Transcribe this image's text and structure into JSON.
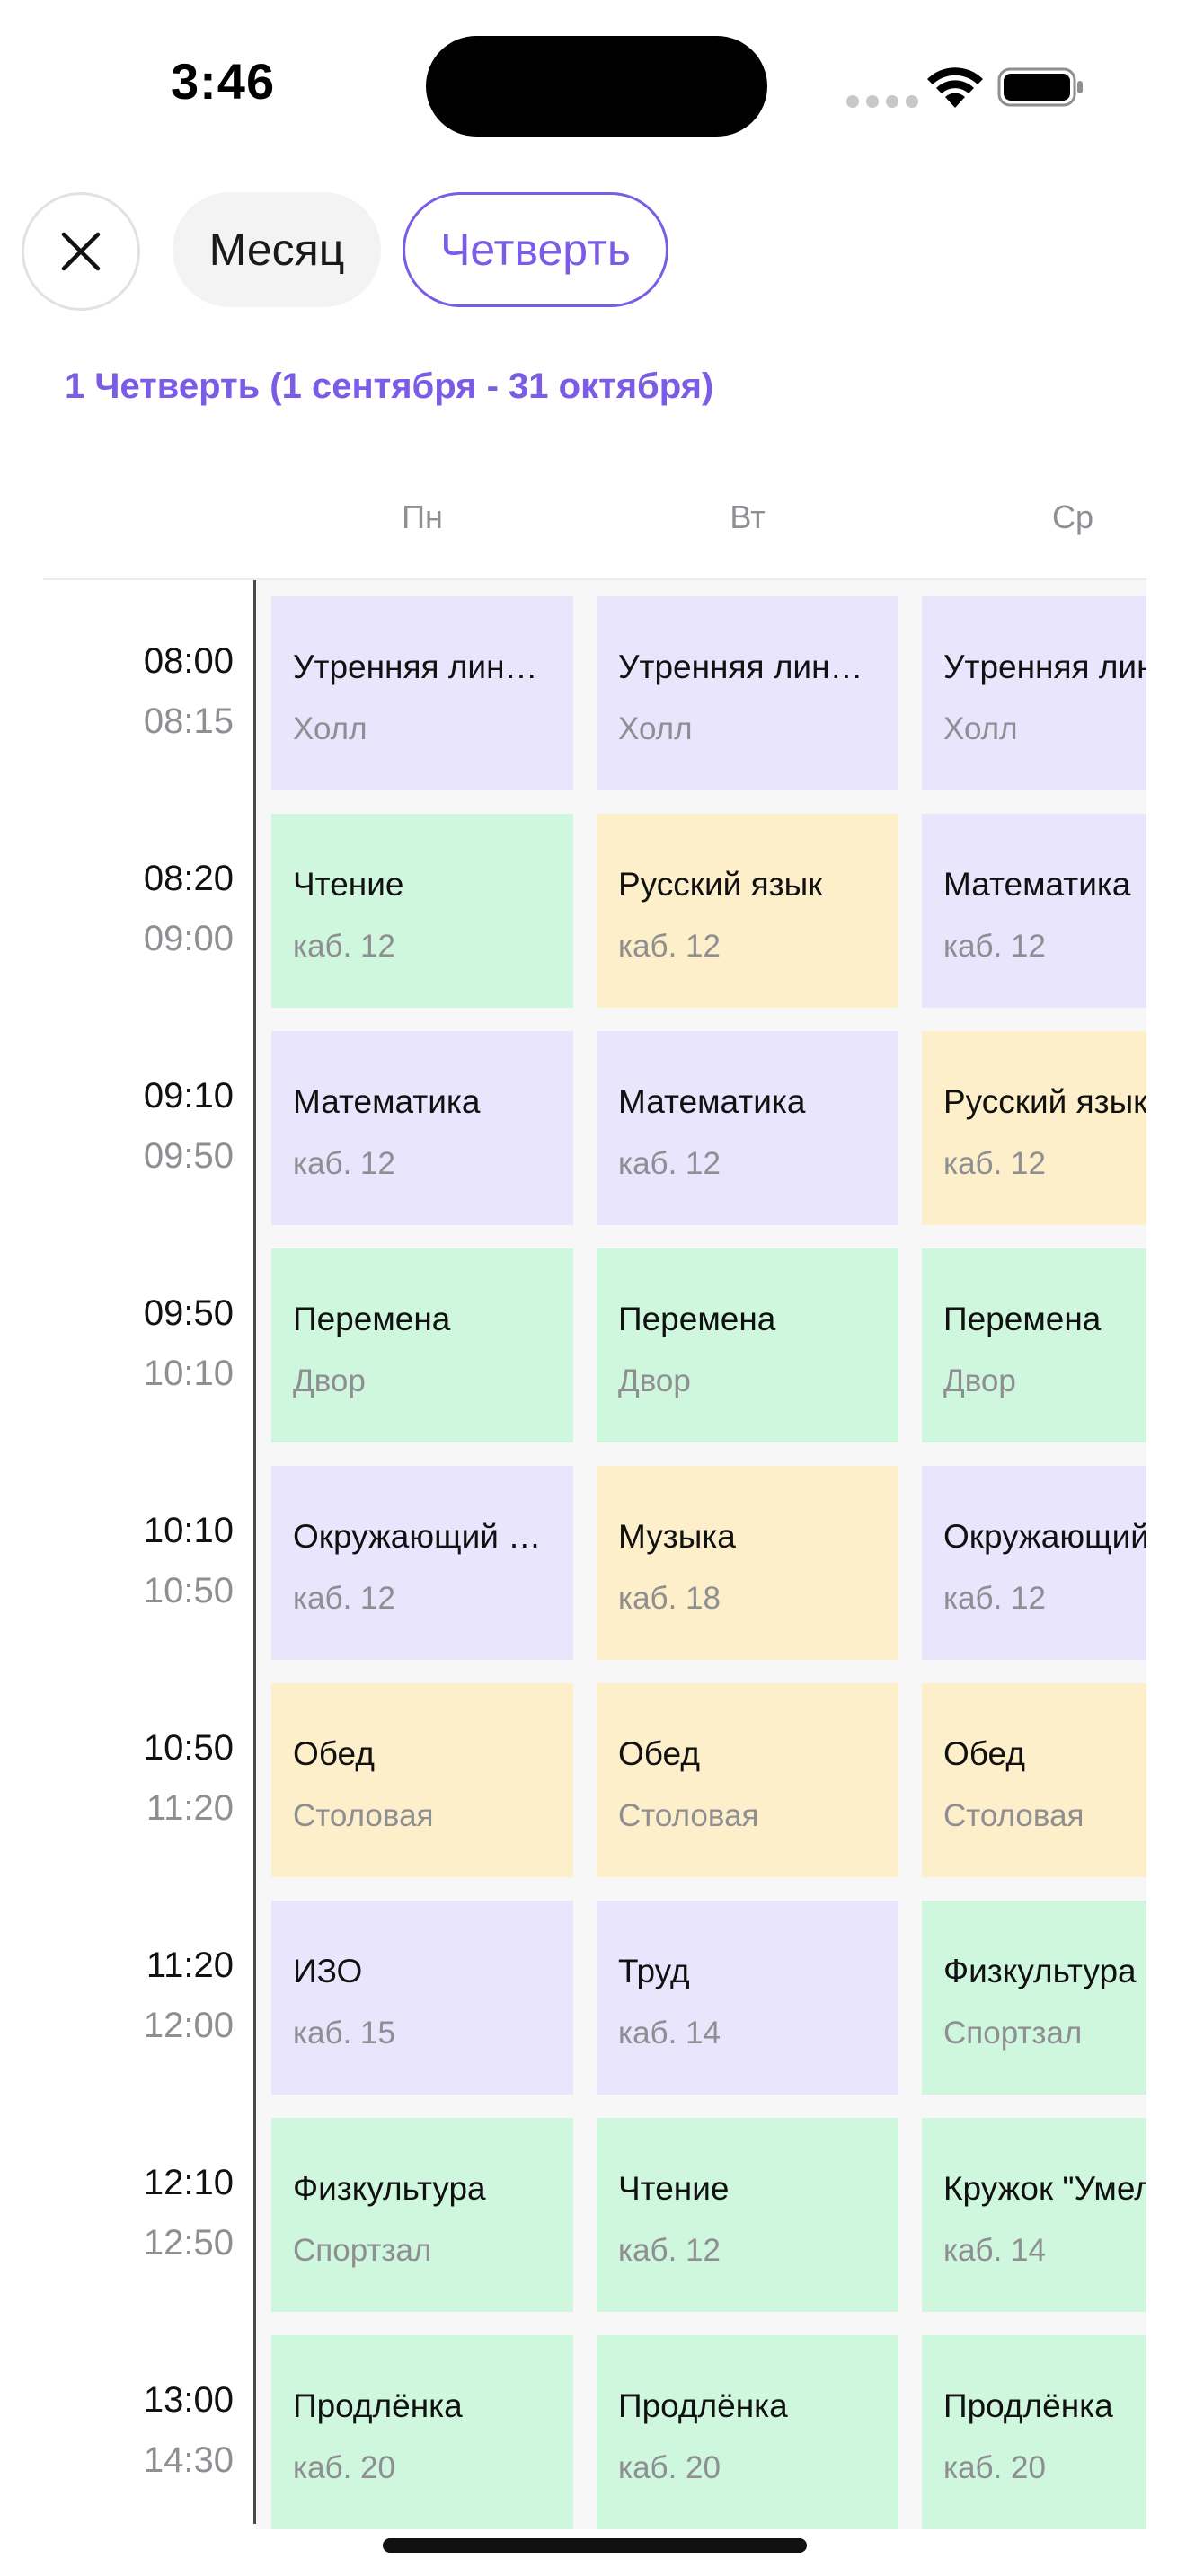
{
  "status_bar": {
    "time": "3:46"
  },
  "filters": {
    "month_label": "Месяц",
    "quarter_label": "Четверть",
    "selected": "Четверть"
  },
  "quarter_title": "1 Четверть (1 сентября - 31 октября)",
  "days": [
    "Пн",
    "Вт",
    "Ср"
  ],
  "colors": {
    "accent": "#7a5ce6",
    "purple": "#e8e5fd",
    "green": "#cff7dd",
    "yellow": "#fdefc9"
  },
  "slots": [
    {
      "start": "08:00",
      "end": "08:15",
      "lessons": [
        {
          "title": "Утренняя линейка",
          "room": "Холл",
          "color": "purple"
        },
        {
          "title": "Утренняя линейка",
          "room": "Холл",
          "color": "purple"
        },
        {
          "title": "Утренняя линейка",
          "room": "Холл",
          "color": "purple"
        }
      ]
    },
    {
      "start": "08:20",
      "end": "09:00",
      "lessons": [
        {
          "title": "Чтение",
          "room": "каб. 12",
          "color": "green"
        },
        {
          "title": "Русский язык",
          "room": "каб. 12",
          "color": "yellow"
        },
        {
          "title": "Математика",
          "room": "каб. 12",
          "color": "purple"
        }
      ]
    },
    {
      "start": "09:10",
      "end": "09:50",
      "lessons": [
        {
          "title": "Математика",
          "room": "каб. 12",
          "color": "purple"
        },
        {
          "title": "Математика",
          "room": "каб. 12",
          "color": "purple"
        },
        {
          "title": "Русский язык",
          "room": "каб. 12",
          "color": "yellow"
        }
      ]
    },
    {
      "start": "09:50",
      "end": "10:10",
      "lessons": [
        {
          "title": "Перемена",
          "room": "Двор",
          "color": "green"
        },
        {
          "title": "Перемена",
          "room": "Двор",
          "color": "green"
        },
        {
          "title": "Перемена",
          "room": "Двор",
          "color": "green"
        }
      ]
    },
    {
      "start": "10:10",
      "end": "10:50",
      "lessons": [
        {
          "title": "Окружающий мир",
          "room": "каб. 12",
          "color": "purple"
        },
        {
          "title": "Музыка",
          "room": "каб. 18",
          "color": "yellow"
        },
        {
          "title": "Окружающий мир",
          "room": "каб. 12",
          "color": "purple"
        }
      ]
    },
    {
      "start": "10:50",
      "end": "11:20",
      "lessons": [
        {
          "title": "Обед",
          "room": "Столовая",
          "color": "yellow"
        },
        {
          "title": "Обед",
          "room": "Столовая",
          "color": "yellow"
        },
        {
          "title": "Обед",
          "room": "Столовая",
          "color": "yellow"
        }
      ]
    },
    {
      "start": "11:20",
      "end": "12:00",
      "lessons": [
        {
          "title": "ИЗО",
          "room": "каб. 15",
          "color": "purple"
        },
        {
          "title": "Труд",
          "room": "каб. 14",
          "color": "purple"
        },
        {
          "title": "Физкультура",
          "room": "Спортзал",
          "color": "green"
        }
      ]
    },
    {
      "start": "12:10",
      "end": "12:50",
      "lessons": [
        {
          "title": "Физкультура",
          "room": "Спортзал",
          "color": "green"
        },
        {
          "title": "Чтение",
          "room": "каб. 12",
          "color": "green"
        },
        {
          "title": "Кружок \"Умелые руки\"",
          "room": "каб. 14",
          "color": "green"
        }
      ]
    },
    {
      "start": "13:00",
      "end": "14:30",
      "lessons": [
        {
          "title": "Продлёнка",
          "room": "каб. 20",
          "color": "green"
        },
        {
          "title": "Продлёнка",
          "room": "каб. 20",
          "color": "green"
        },
        {
          "title": "Продлёнка",
          "room": "каб. 20",
          "color": "green"
        }
      ]
    }
  ]
}
